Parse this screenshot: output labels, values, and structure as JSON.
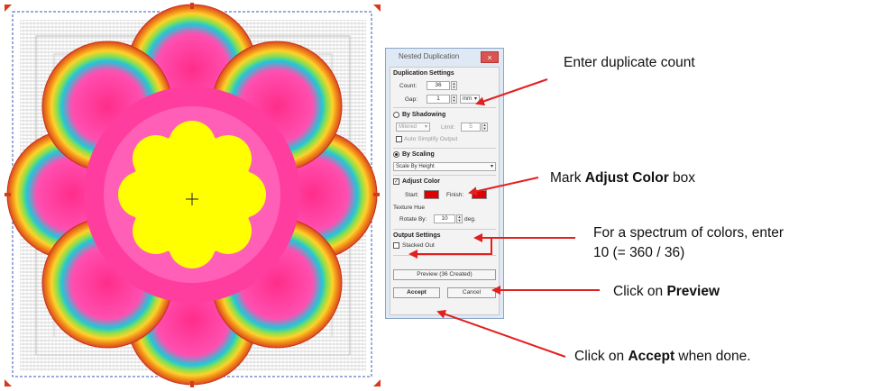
{
  "dialog": {
    "title": "Nested Duplication",
    "close_label": "×",
    "duplication_settings": {
      "heading": "Duplication Settings",
      "count_label": "Count:",
      "count_value": "36",
      "gap_label": "Gap:",
      "gap_value": "1",
      "gap_unit": "mm"
    },
    "by_shadowing": {
      "label": "By Shadowing",
      "join_option": "Mitered",
      "limit_label": "Limit:",
      "limit_value": "5",
      "auto_simplify_label": "Auto Simplify Output"
    },
    "by_scaling": {
      "label": "By Scaling",
      "scale_option": "Scale By Height"
    },
    "adjust_color": {
      "label": "Adjust Color",
      "checked": true,
      "start_label": "Start:",
      "finish_label": "Finish:",
      "start_color": "#e00000",
      "finish_color": "#e00000",
      "texture_hue_label": "Texture Hue",
      "rotate_label": "Rotate By:",
      "rotate_value": "10",
      "rotate_unit": "deg."
    },
    "output_settings": {
      "heading": "Output Settings",
      "stacked_out_label": "Stacked Out"
    },
    "preview_button": "Preview (36 Created)",
    "accept_button": "Accept",
    "cancel_button": "Cancel"
  },
  "callouts": {
    "count": "Enter duplicate count",
    "adjust_color_prefix": "Mark ",
    "adjust_color_bold": "Adjust Color",
    "adjust_color_suffix": " box",
    "rotate_line1": "For a spectrum of colors, enter",
    "rotate_line2": "10 (= 360 / 36)",
    "preview_prefix": "Click on ",
    "preview_bold": "Preview",
    "accept_prefix": "Click on ",
    "accept_bold": "Accept",
    "accept_suffix": " when done."
  },
  "colors": {
    "arrow": "#e32020",
    "handles": "#d63a1a",
    "selection_border": "#3b55b5",
    "flower_center": "#ffff00"
  }
}
